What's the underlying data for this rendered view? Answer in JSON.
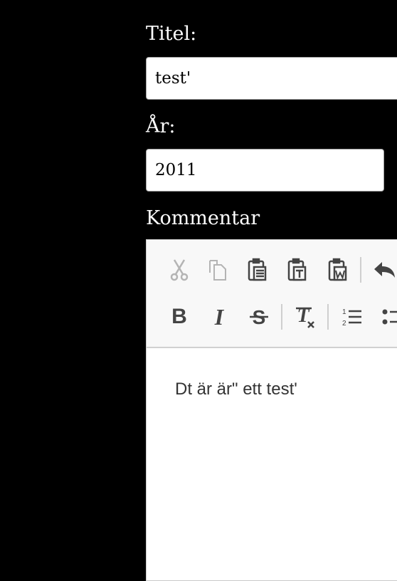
{
  "form": {
    "title_label": "Titel:",
    "title_value": "test'",
    "year_label": "År:",
    "year_value": "2011",
    "comment_label": "Kommentar"
  },
  "editor": {
    "toolbar_row1": [
      "cut-icon",
      "copy-icon",
      "paste-icon",
      "paste-text-icon",
      "paste-word-icon",
      "undo-icon"
    ],
    "toolbar_row2": [
      "bold-icon",
      "italic-icon",
      "strikethrough-icon",
      "remove-format-icon",
      "numbered-list-icon",
      "bullet-list-icon"
    ],
    "content_text": "Dt är är\" ett test'"
  },
  "colors": {
    "background": "#000000",
    "toolbar_bg": "#f8f8f8",
    "icon": "#444444",
    "icon_disabled": "#b4b4b4"
  }
}
